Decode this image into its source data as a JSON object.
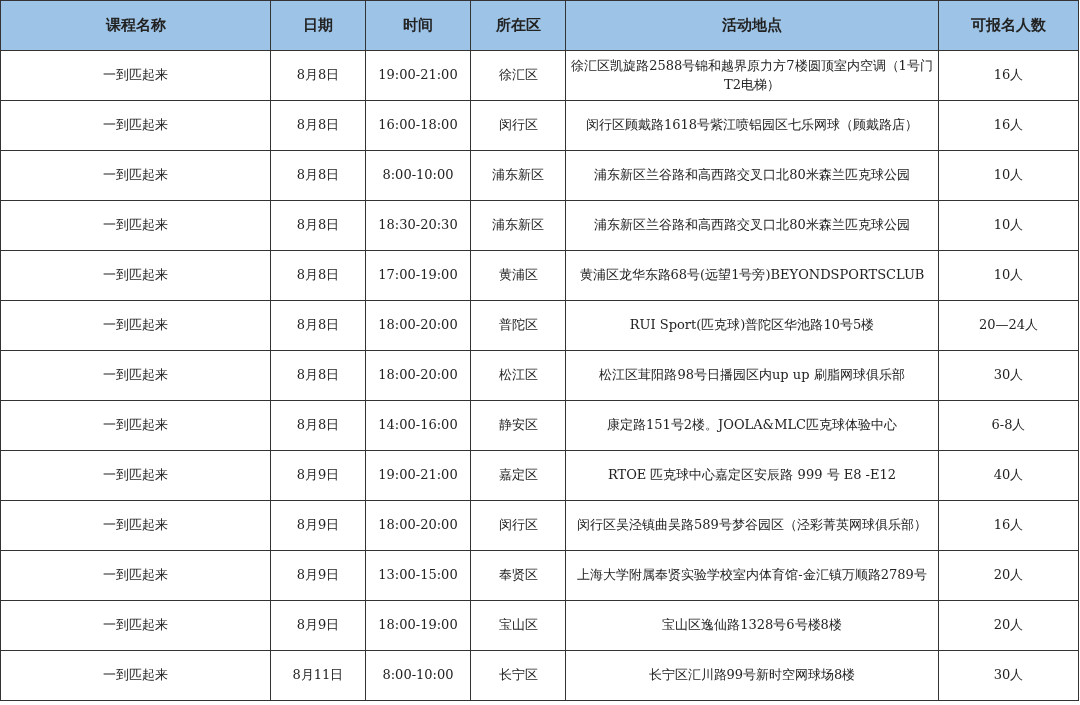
{
  "table": {
    "columns": [
      "课程名称",
      "日期",
      "时间",
      "所在区",
      "活动地点",
      "可报名人数"
    ],
    "rows": [
      [
        "一到匹起来",
        "8月8日",
        "19:00-21:00",
        "徐汇区",
        "徐汇区凯旋路2588号锦和越界原力方7楼圆顶室内空调（1号门T2电梯）",
        "16人"
      ],
      [
        "一到匹起来",
        "8月8日",
        "16:00-18:00",
        "闵行区",
        "闵行区顾戴路1618号紫江喷铝园区七乐网球（顾戴路店）",
        "16人"
      ],
      [
        "一到匹起来",
        "8月8日",
        "8:00-10:00",
        "浦东新区",
        "浦东新区兰谷路和高西路交叉口北80米森兰匹克球公园",
        "10人"
      ],
      [
        "一到匹起来",
        "8月8日",
        "18:30-20:30",
        "浦东新区",
        "浦东新区兰谷路和高西路交叉口北80米森兰匹克球公园",
        "10人"
      ],
      [
        "一到匹起来",
        "8月8日",
        "17:00-19:00",
        "黄浦区",
        "黄浦区龙华东路68号(远望1号旁)BEYONDSPORTSCLUB",
        "10人"
      ],
      [
        "一到匹起来",
        "8月8日",
        "18:00-20:00",
        "普陀区",
        "RUI Sport(匹克球)普陀区华池路10号5楼",
        "20—24人"
      ],
      [
        "一到匹起来",
        "8月8日",
        "18:00-20:00",
        "松江区",
        "松江区茸阳路98号日播园区内up up 刷脂网球俱乐部",
        "30人"
      ],
      [
        "一到匹起来",
        "8月8日",
        "14:00-16:00",
        "静安区",
        "康定路151号2楼。JOOLA&MLC匹克球体验中心",
        "6-8人"
      ],
      [
        "一到匹起来",
        "8月9日",
        "19:00-21:00",
        "嘉定区",
        "RTOE 匹克球中心嘉定区安辰路 999 号 E8 -E12",
        "40人"
      ],
      [
        "一到匹起来",
        "8月9日",
        "18:00-20:00",
        "闵行区",
        "闵行区吴泾镇曲吴路589号梦谷园区（泾彩菁英网球俱乐部）",
        "16人"
      ],
      [
        "一到匹起来",
        "8月9日",
        "13:00-15:00",
        "奉贤区",
        "上海大学附属奉贤实验学校室内体育馆-金汇镇万顺路2789号",
        "20人"
      ],
      [
        "一到匹起来",
        "8月9日",
        "18:00-19:00",
        "宝山区",
        "宝山区逸仙路1328号6号楼8楼",
        "20人"
      ],
      [
        "一到匹起来",
        "8月11日",
        "8:00-10:00",
        "长宁区",
        "长宁区汇川路99号新时空网球场8楼",
        "30人"
      ]
    ]
  }
}
